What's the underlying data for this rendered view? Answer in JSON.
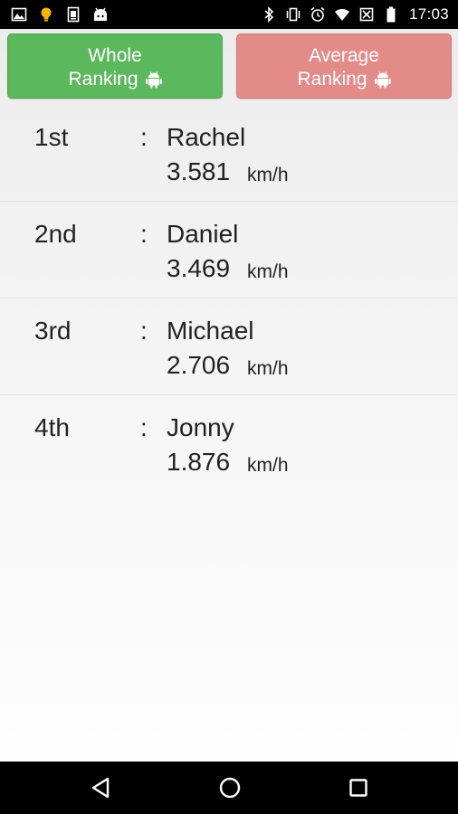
{
  "status_bar": {
    "time": "17:03",
    "left_icons": [
      "image-icon",
      "lightbulb-icon",
      "sim-card-icon",
      "android-face-icon"
    ],
    "right_icons": [
      "bluetooth-icon",
      "vibrate-icon",
      "alarm-icon",
      "wifi-icon",
      "signal-off-icon",
      "battery-icon"
    ]
  },
  "tabs": {
    "whole": {
      "line1": "Whole",
      "line2": "Ranking",
      "color": "#5cb85c"
    },
    "average": {
      "line1": "Average",
      "line2": "Ranking",
      "color": "#e38b88"
    }
  },
  "separator": ":",
  "unit": "km/h",
  "rankings": [
    {
      "position": "1st",
      "name": "Rachel",
      "speed": "3.581"
    },
    {
      "position": "2nd",
      "name": "Daniel",
      "speed": "3.469"
    },
    {
      "position": "3rd",
      "name": "Michael",
      "speed": "2.706"
    },
    {
      "position": "4th",
      "name": "Jonny",
      "speed": "1.876"
    }
  ],
  "nav_bar": {
    "icons": [
      "back-icon",
      "home-icon",
      "recents-icon"
    ]
  }
}
